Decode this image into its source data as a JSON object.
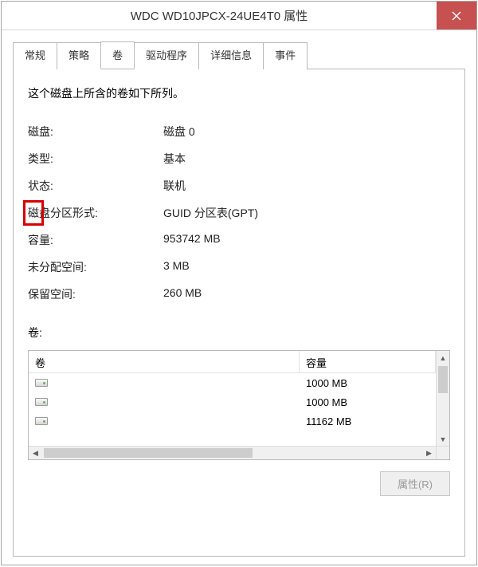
{
  "window": {
    "title": "WDC WD10JPCX-24UE4T0 属性"
  },
  "tabs": [
    {
      "label": "常规"
    },
    {
      "label": "策略"
    },
    {
      "label": "卷"
    },
    {
      "label": "驱动程序"
    },
    {
      "label": "详细信息"
    },
    {
      "label": "事件"
    }
  ],
  "active_tab_index": 2,
  "volumes_tab": {
    "intro": "这个磁盘上所含的卷如下所列。",
    "properties": [
      {
        "label": "磁盘:",
        "value": "磁盘 0"
      },
      {
        "label": "类型:",
        "value": "基本"
      },
      {
        "label": "状态:",
        "value": "联机"
      },
      {
        "label": "磁盘分区形式:",
        "value": "GUID 分区表(GPT)",
        "highlight": true
      },
      {
        "label": "容量:",
        "value": "953742 MB"
      },
      {
        "label": "未分配空间:",
        "value": "3 MB"
      },
      {
        "label": "保留空间:",
        "value": "260 MB"
      }
    ],
    "volumes_label": "卷:",
    "list_headers": {
      "name": "卷",
      "size": "容量"
    },
    "volumes": [
      {
        "name": "",
        "size": "1000 MB"
      },
      {
        "name": "",
        "size": "1000 MB"
      },
      {
        "name": "",
        "size": "11162 MB"
      }
    ],
    "properties_button": "属性(R)"
  }
}
